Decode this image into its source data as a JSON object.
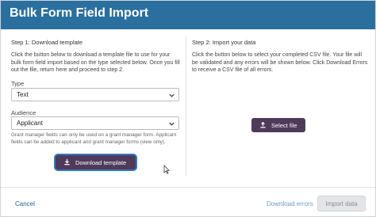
{
  "header": {
    "title": "Bulk Form Field Import"
  },
  "step1": {
    "title": "Step 1: Download template",
    "description": "Click the button below to download a template file to use for your bulk form field import based on the type selected below. Once you fill out the file, return here and proceed to step 2.",
    "type_label": "Type",
    "type_value": "Text",
    "audience_label": "Audience",
    "audience_value": "Applicant",
    "hint": "Grant manager fields can only be used on a grant manager form. Applicant fields can be added to applicant and grant manager forms (view only).",
    "download_button": "Download template",
    "download_icon": "download-icon"
  },
  "step2": {
    "title": "Step 2: Import your data",
    "description": "Click the button below to select your completed CSV file. Your file will be validated and any errors will be shown below. Click Download Errors to receive a CSV file of all errors.",
    "select_button": "Select file",
    "select_icon": "upload-icon"
  },
  "footer": {
    "cancel": "Cancel",
    "download_errors": "Download errors",
    "import_data": "Import data"
  },
  "colors": {
    "header": "#2a6f9e",
    "primary_button": "#4f3a5c",
    "link": "#1f5f98",
    "disabled_link": "#6b9bc4",
    "focus_ring": "#2f7bbf"
  }
}
